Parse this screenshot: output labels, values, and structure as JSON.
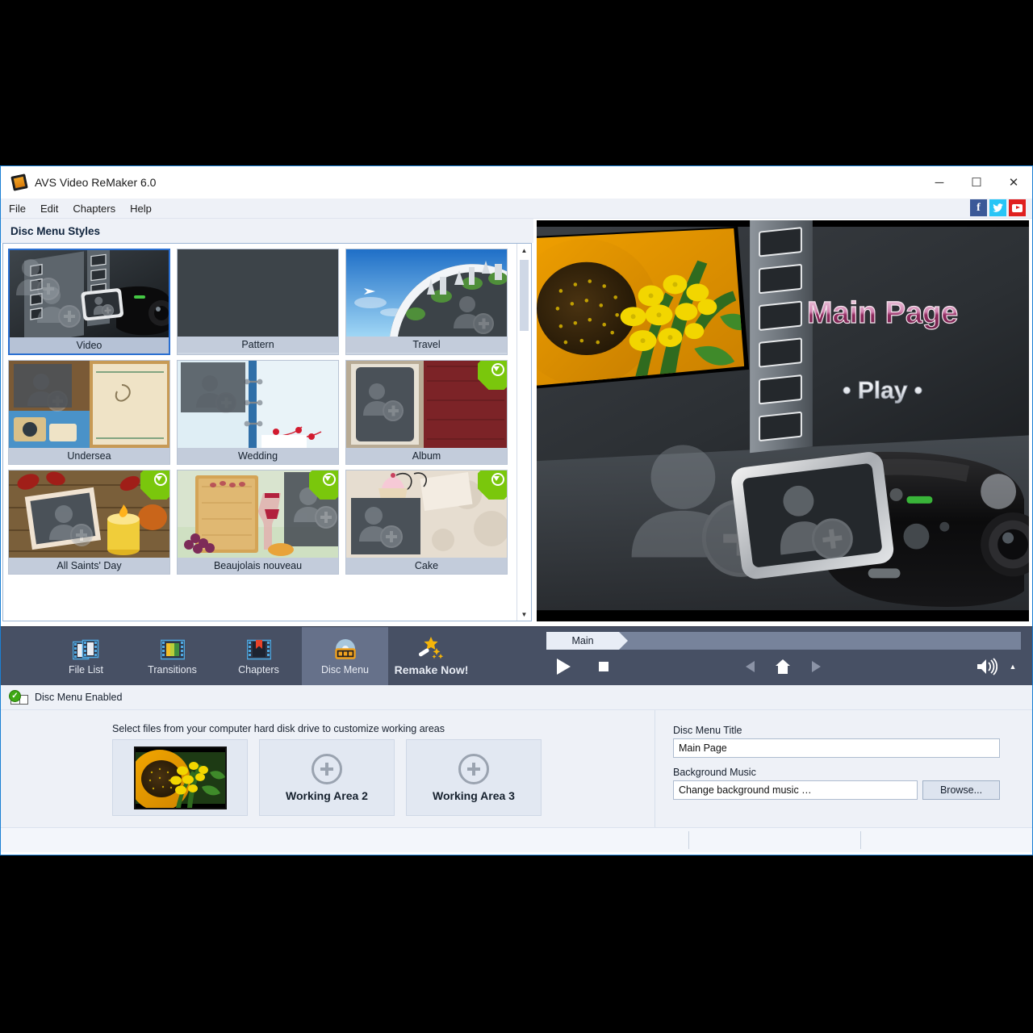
{
  "window": {
    "title": "AVS Video ReMaker 6.0",
    "app_icon": "film-reel-icon",
    "minimize": "─",
    "maximize": "☐",
    "close": "✕"
  },
  "menubar": {
    "items": [
      "File",
      "Edit",
      "Chapters",
      "Help"
    ],
    "social": [
      {
        "name": "facebook-icon",
        "glyph": "f"
      },
      {
        "name": "twitter-icon",
        "glyph": "t"
      },
      {
        "name": "youtube-icon",
        "glyph": ""
      }
    ]
  },
  "styles_panel": {
    "header": "Disc Menu Styles",
    "selected": "Video",
    "items": [
      {
        "label": "Video",
        "downloadable": false,
        "selected": true
      },
      {
        "label": "Pattern",
        "downloadable": false,
        "selected": false
      },
      {
        "label": "Travel",
        "downloadable": false,
        "selected": false
      },
      {
        "label": "Undersea",
        "downloadable": false,
        "selected": false
      },
      {
        "label": "Wedding",
        "downloadable": false,
        "selected": false
      },
      {
        "label": "Album",
        "downloadable": true,
        "selected": false
      },
      {
        "label": "All Saints' Day",
        "downloadable": true,
        "selected": false
      },
      {
        "label": "Beaujolais nouveau",
        "downloadable": true,
        "selected": false
      },
      {
        "label": "Cake",
        "downloadable": true,
        "selected": false
      }
    ],
    "scroll_up": "▲",
    "scroll_down": "▼"
  },
  "preview": {
    "menu_title": "Main Page",
    "play_label": "• Play •"
  },
  "toolbar": {
    "tabs": [
      {
        "label": "File List",
        "icon": "film-strip-icon",
        "active": false
      },
      {
        "label": "Transitions",
        "icon": "transitions-icon",
        "active": false
      },
      {
        "label": "Chapters",
        "icon": "bookmark-icon",
        "active": false
      },
      {
        "label": "Disc Menu",
        "icon": "disc-menu-icon",
        "active": true
      }
    ],
    "remake": {
      "label": "Remake Now!",
      "icon": "magic-wand-icon"
    }
  },
  "player": {
    "breadcrumb": "Main",
    "play": "▶",
    "stop": "■",
    "prev": "◀",
    "home": "home-icon",
    "next": "▶",
    "volume": "speaker-icon",
    "volume_expand": "▲"
  },
  "disc_menu": {
    "enabled_label": "Disc Menu Enabled",
    "enabled_icon": "disc-menu-checked-icon",
    "hint": "Select files from your computer hard disk drive to customize working areas",
    "areas": [
      {
        "label": "",
        "has_image": true,
        "image": "sunflower-thumbnail"
      },
      {
        "label": "Working Area 2",
        "has_image": false
      },
      {
        "label": "Working Area 3",
        "has_image": false
      }
    ],
    "title_label": "Disc Menu Title",
    "title_value": "Main Page",
    "music_label": "Background Music",
    "music_value": "Change background music …",
    "browse_label": "Browse..."
  },
  "colors": {
    "accent_blue": "#1a7fd4",
    "toolbar_bg": "#475064",
    "toolbar_active": "#66718a",
    "panel_bg": "#eef1f7",
    "badge_green": "#7ac70c",
    "title_pink": "#c3558f"
  }
}
